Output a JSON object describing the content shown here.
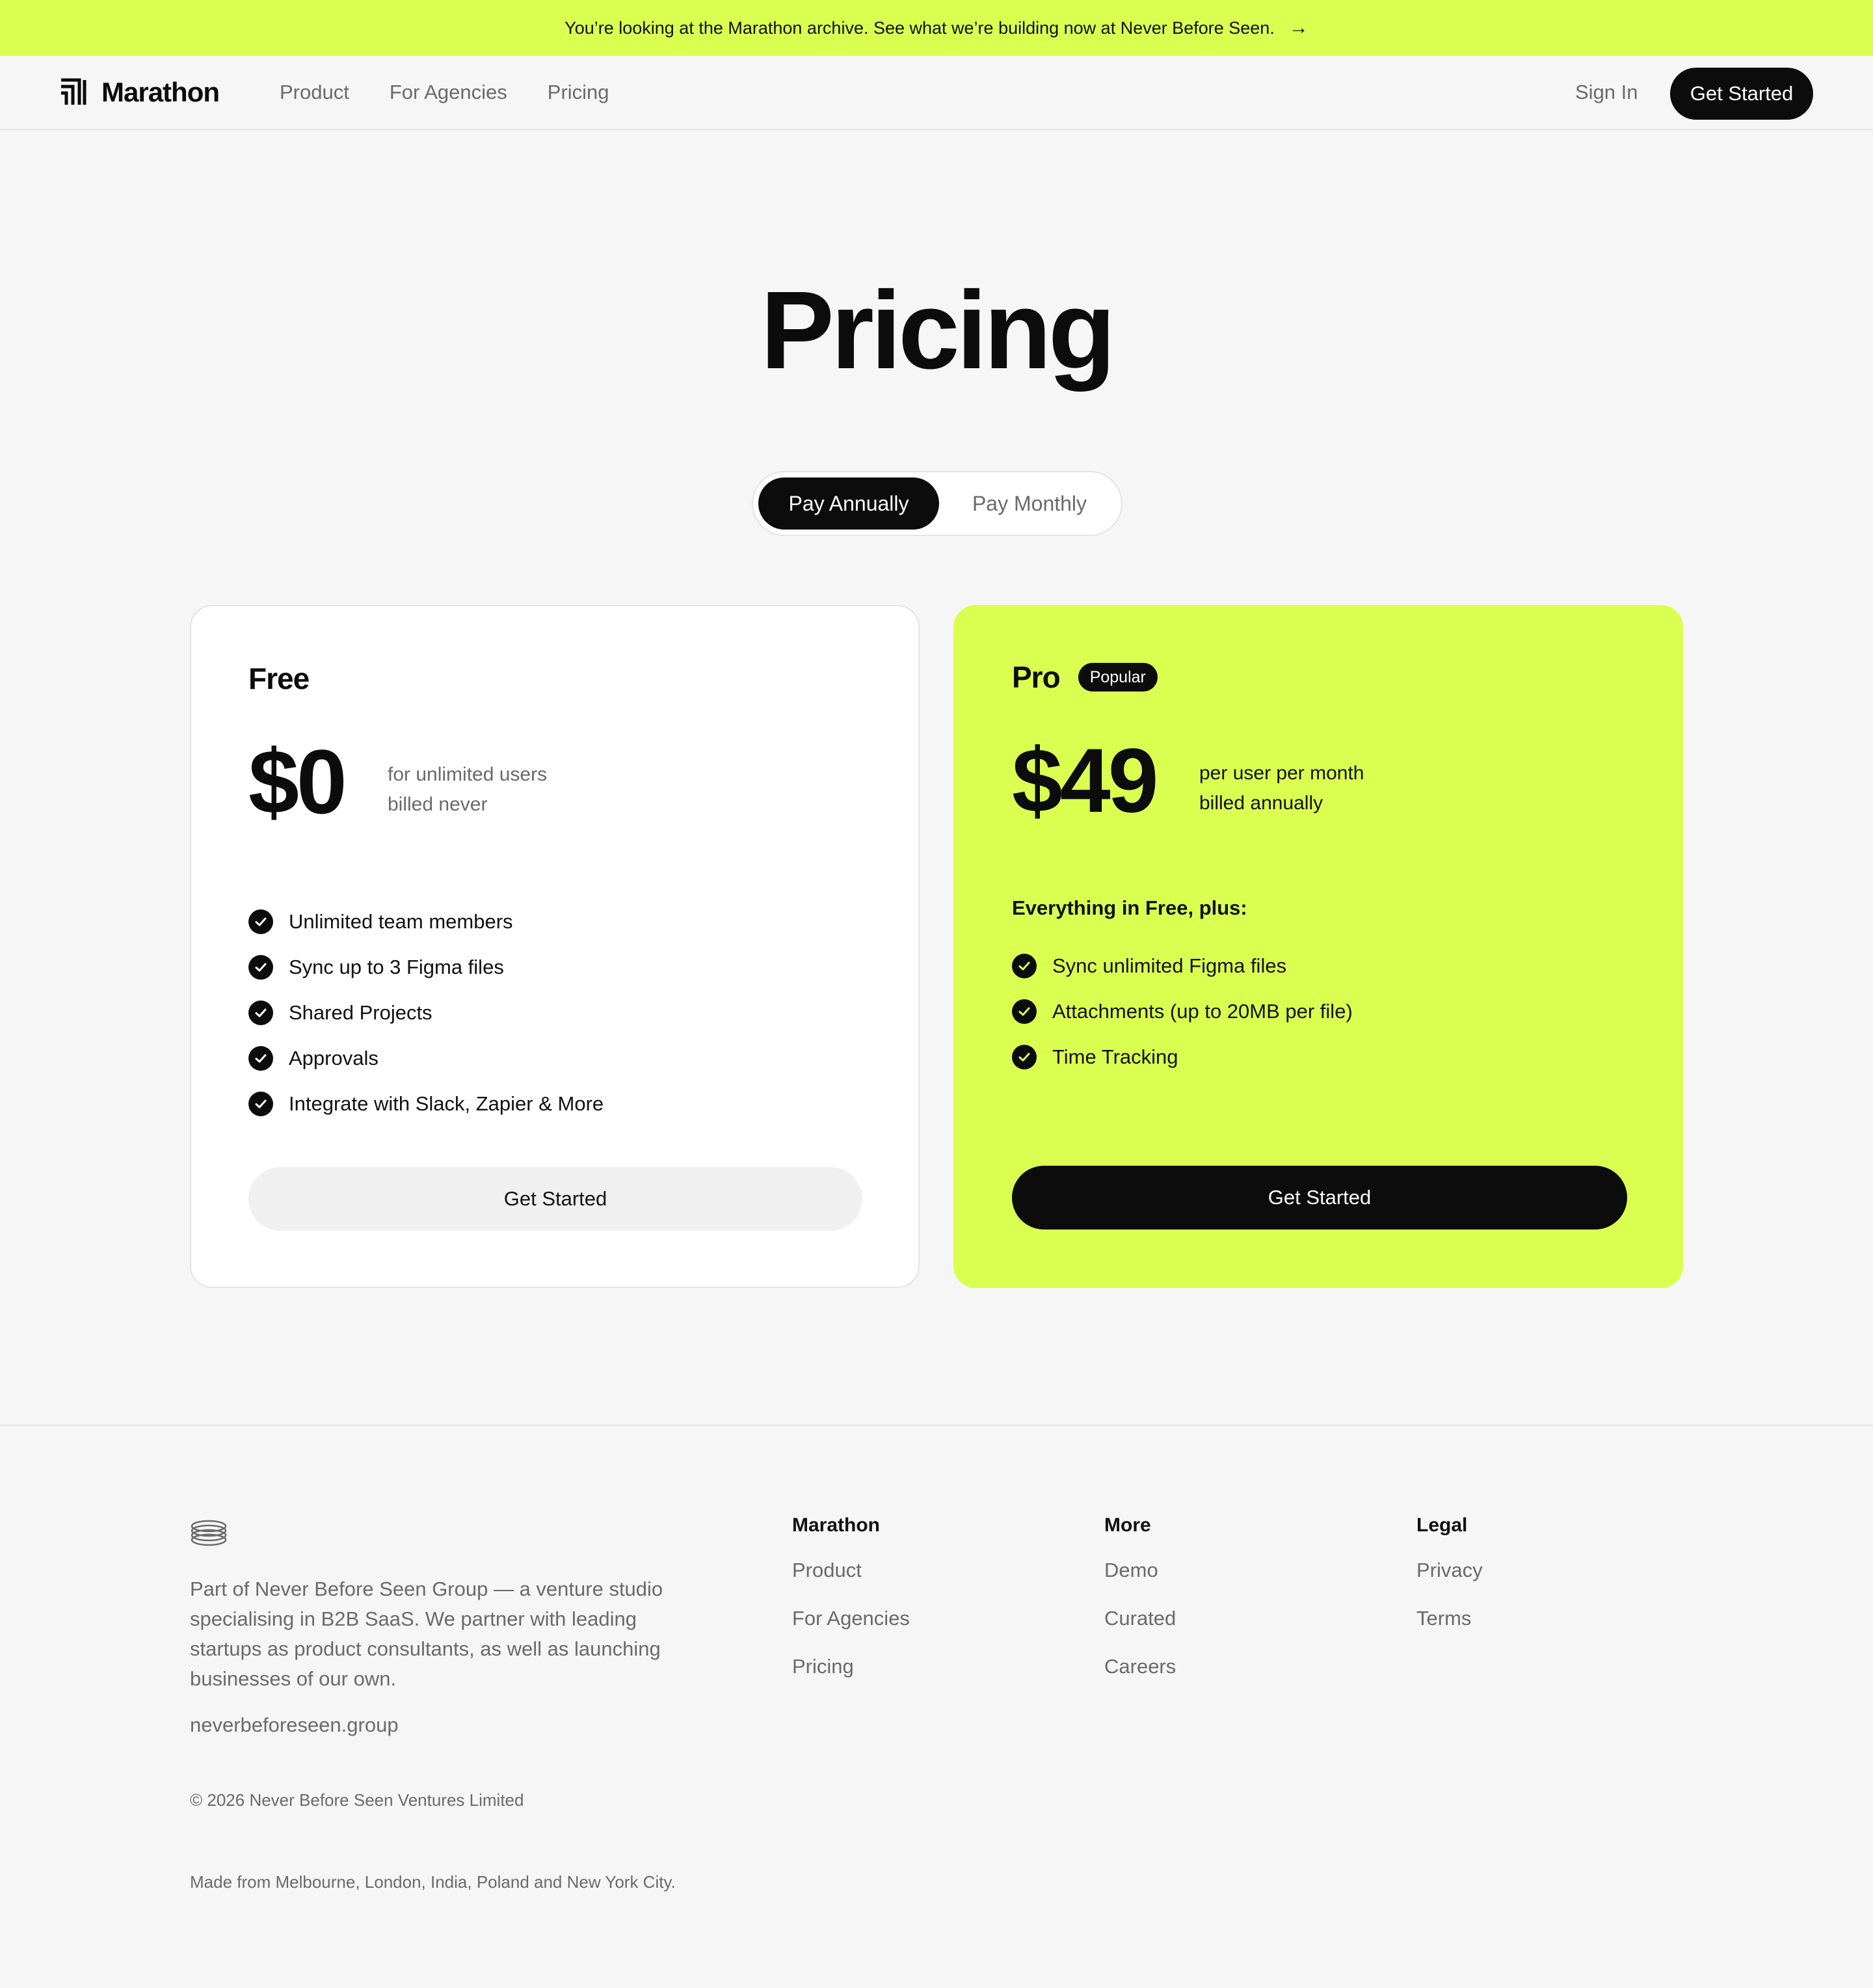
{
  "banner": {
    "text": "You’re looking at the Marathon archive. See what we’re building now at Never Before Seen.",
    "arrow": "→"
  },
  "nav": {
    "brand": "Marathon",
    "links": [
      "Product",
      "For Agencies",
      "Pricing"
    ],
    "sign_in": "Sign In",
    "cta": "Get Started"
  },
  "hero": {
    "title": "Pricing",
    "billing_options": [
      "Pay Annually",
      "Pay Monthly"
    ],
    "selected_billing": "Pay Annually"
  },
  "plans": [
    {
      "name": "Free",
      "price": "$0",
      "note_line1": "for unlimited users",
      "note_line2": "billed never",
      "features": [
        "Unlimited team members",
        "Sync up to 3 Figma files",
        "Shared Projects",
        "Approvals",
        "Integrate with Slack, Zapier & More"
      ],
      "cta": "Get Started"
    },
    {
      "name": "Pro",
      "badge": "Popular",
      "price": "$49",
      "note_line1": "per user per month",
      "note_line2": "billed annually",
      "features_heading": "Everything in Free, plus:",
      "features": [
        "Sync unlimited Figma files",
        "Attachments (up to 20MB per file)",
        "Time Tracking"
      ],
      "cta": "Get Started"
    }
  ],
  "footer": {
    "about": "Part of Never Before Seen Group — a venture studio specialising in B2B SaaS. We partner with leading startups as product consultants, as well as launching businesses of our own.",
    "site": "neverbeforeseen.group",
    "copyright": "© 2026 Never Before Seen Ventures Limited",
    "made_from": "Made from Melbourne, London, India, Poland and New York City.",
    "columns": [
      {
        "heading": "Marathon",
        "links": [
          "Product",
          "For Agencies",
          "Pricing"
        ]
      },
      {
        "heading": "More",
        "links": [
          "Demo",
          "Curated",
          "Careers"
        ]
      },
      {
        "heading": "Legal",
        "links": [
          "Privacy",
          "Terms"
        ]
      }
    ]
  },
  "colors": {
    "accent": "#dbff51",
    "dark": "#0c0c0c",
    "background": "#f6f6f6",
    "muted_text": "#6a6a6a"
  },
  "icons": {
    "brand": "marathon-logo-icon",
    "banner_arrow": "arrow-right-icon",
    "feature_check": "check-circle-icon",
    "footer_logo": "never-before-seen-logo-icon"
  }
}
